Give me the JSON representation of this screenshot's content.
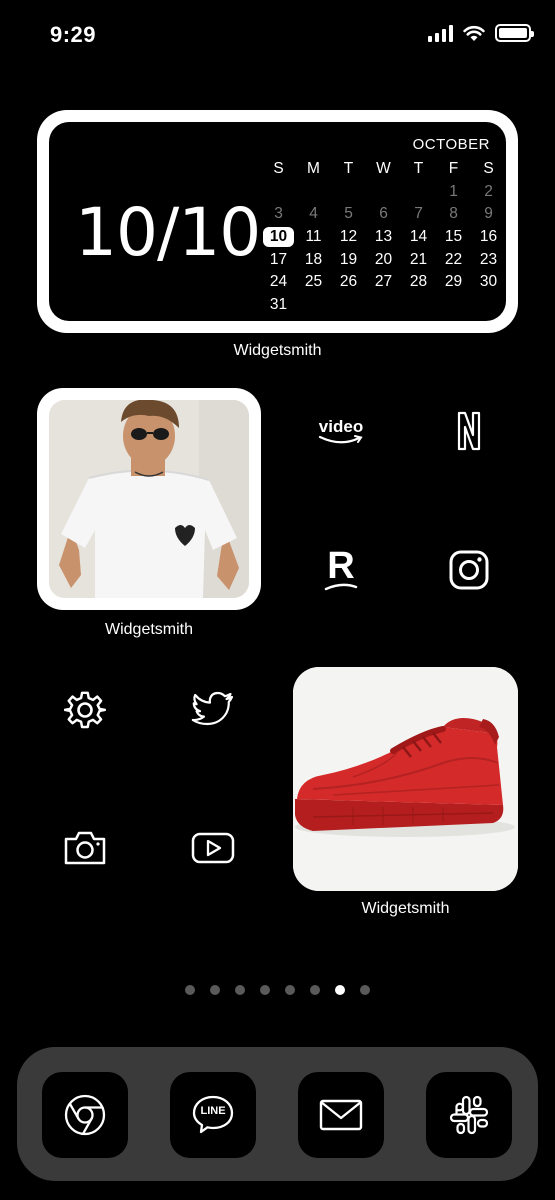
{
  "status_bar": {
    "time": "9:29",
    "battery_level": 1.0
  },
  "calendar_widget": {
    "big_date": "10/10",
    "month": "OCTOBER",
    "weekday_headers": [
      "S",
      "M",
      "T",
      "W",
      "T",
      "F",
      "S"
    ],
    "days": [
      {
        "d": "",
        "dim": false
      },
      {
        "d": "",
        "dim": false
      },
      {
        "d": "",
        "dim": false
      },
      {
        "d": "",
        "dim": false
      },
      {
        "d": "",
        "dim": false
      },
      {
        "d": "1",
        "dim": true
      },
      {
        "d": "2",
        "dim": true
      },
      {
        "d": "3",
        "dim": true
      },
      {
        "d": "4",
        "dim": true
      },
      {
        "d": "5",
        "dim": true
      },
      {
        "d": "6",
        "dim": true
      },
      {
        "d": "7",
        "dim": true
      },
      {
        "d": "8",
        "dim": true
      },
      {
        "d": "9",
        "dim": true
      },
      {
        "d": "10",
        "today": true
      },
      {
        "d": "11"
      },
      {
        "d": "12"
      },
      {
        "d": "13"
      },
      {
        "d": "14"
      },
      {
        "d": "15"
      },
      {
        "d": "16"
      },
      {
        "d": "17"
      },
      {
        "d": "18"
      },
      {
        "d": "19"
      },
      {
        "d": "20"
      },
      {
        "d": "21"
      },
      {
        "d": "22"
      },
      {
        "d": "23"
      },
      {
        "d": "24"
      },
      {
        "d": "25"
      },
      {
        "d": "26"
      },
      {
        "d": "27"
      },
      {
        "d": "28"
      },
      {
        "d": "29"
      },
      {
        "d": "30"
      },
      {
        "d": "31"
      }
    ],
    "label": "Widgetsmith"
  },
  "photo_widget": {
    "label": "Widgetsmith"
  },
  "shoe_widget": {
    "label": "Widgetsmith"
  },
  "apps": {
    "prime_video": {
      "icon": "prime-video-icon",
      "text": "video"
    },
    "netflix": {
      "icon": "netflix-icon"
    },
    "rakuten": {
      "icon": "rakuten-icon",
      "text": "R"
    },
    "instagram": {
      "icon": "instagram-icon"
    },
    "settings": {
      "icon": "gear-icon"
    },
    "twitter": {
      "icon": "twitter-bird-icon"
    },
    "camera": {
      "icon": "camera-icon"
    },
    "youtube": {
      "icon": "play-icon"
    }
  },
  "page_indicator": {
    "count": 8,
    "active": 7
  },
  "dock": {
    "chrome": {
      "icon": "chrome-icon"
    },
    "line": {
      "icon": "line-icon",
      "text": "LINE"
    },
    "mail": {
      "icon": "mail-icon"
    },
    "slack": {
      "icon": "slack-icon"
    }
  },
  "colors": {
    "background": "#000000",
    "dock": "#3a3a3a",
    "widget_frame": "#ffffff",
    "shoe_red": "#d42a2a"
  }
}
